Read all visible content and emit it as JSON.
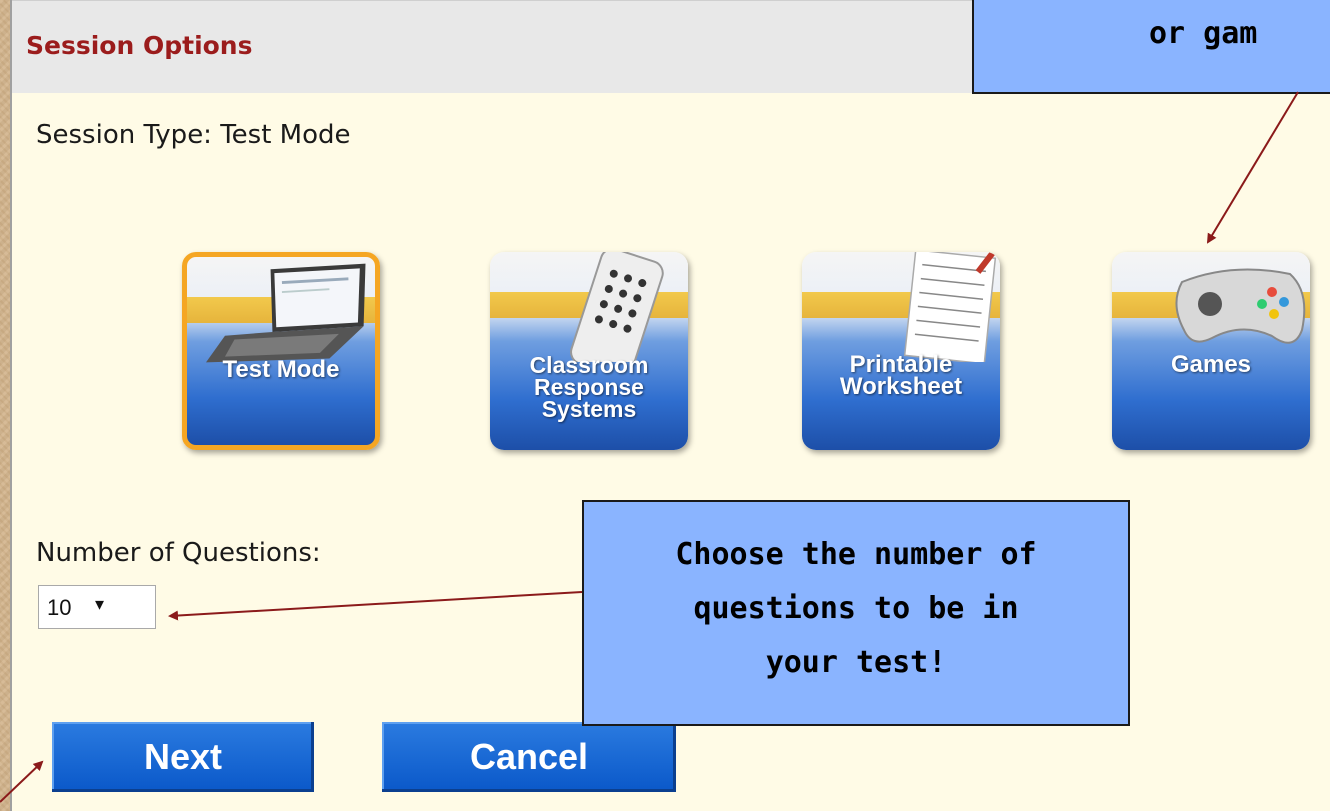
{
  "panel": {
    "title": "Session Options",
    "session_type": "Session Type: Test Mode"
  },
  "modes": [
    {
      "label": "Test Mode",
      "selected": true,
      "icon": "laptop-icon"
    },
    {
      "label": "Classroom\nResponse\nSystems",
      "selected": false,
      "icon": "remote-clicker-icon"
    },
    {
      "label": "Printable\nWorksheet",
      "selected": false,
      "icon": "worksheet-icon"
    },
    {
      "label": "Games",
      "selected": false,
      "icon": "gamepad-icon"
    }
  ],
  "questions": {
    "label": "Number of Questions:",
    "value": "10"
  },
  "buttons": {
    "next": "Next",
    "cancel": "Cancel"
  },
  "callouts": {
    "top": "or gam",
    "middle_line1": "Choose the number of",
    "middle_line2": "questions to be in",
    "middle_line3": "your test!"
  },
  "colors": {
    "title_red": "#9b1c1c",
    "button_blue": "#0a58c9",
    "callout_blue": "#8ab4ff",
    "selected_border": "#f5a623",
    "arrow": "#8b1a1a"
  }
}
